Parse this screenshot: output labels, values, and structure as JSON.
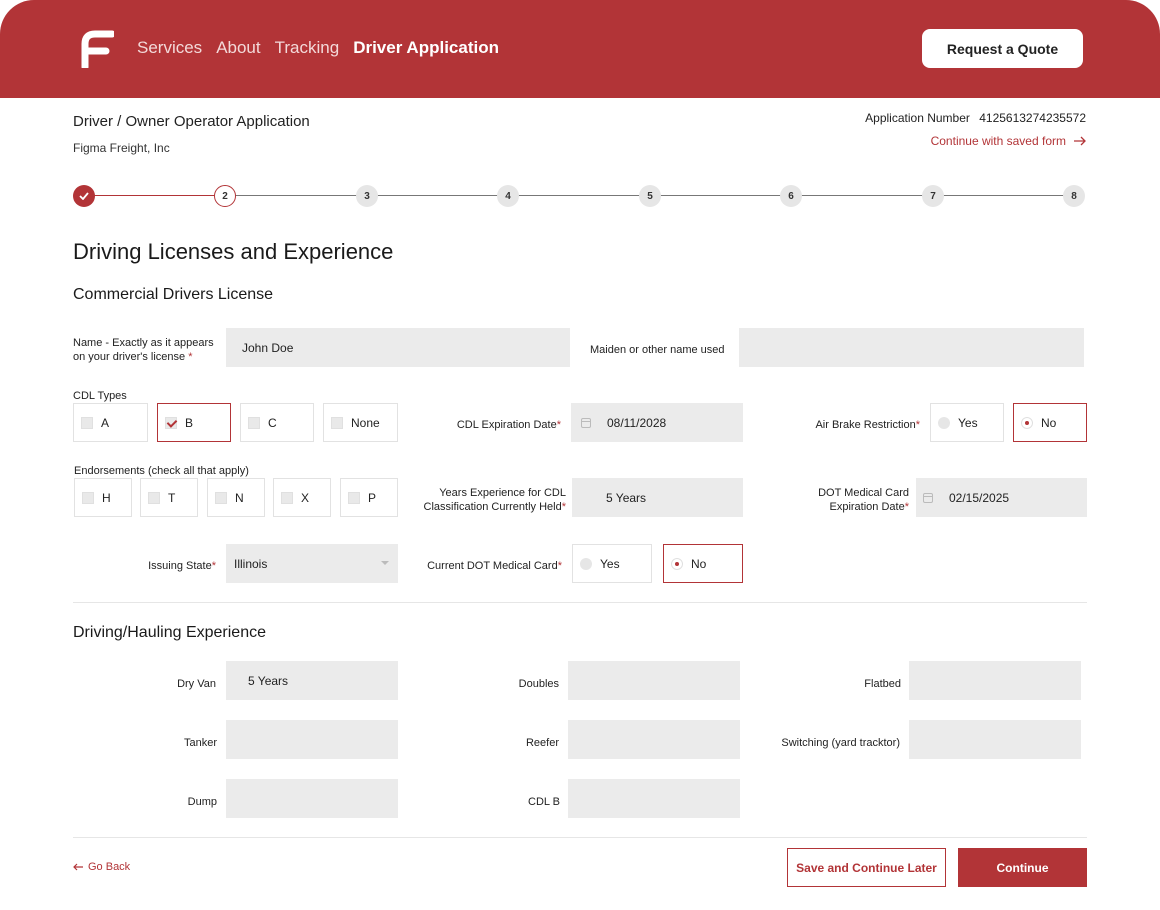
{
  "nav": {
    "items": [
      "Services",
      "About",
      "Tracking",
      "Driver Application"
    ],
    "active_index": 3,
    "quote_button": "Request a Quote"
  },
  "application": {
    "title": "Driver / Owner Operator Application",
    "company": "Figma Freight, Inc",
    "number_label": "Application Number",
    "number": "4125613274235572",
    "saved_link": "Continue with saved form"
  },
  "stepper": {
    "steps": [
      "2",
      "3",
      "4",
      "5",
      "6",
      "7",
      "8"
    ],
    "completed": 1,
    "current": 2,
    "total": 8
  },
  "section": {
    "title": "Driving Licenses and Experience",
    "cdl_heading": "Commercial Drivers License",
    "hauling_heading": "Driving/Hauling Experience"
  },
  "cdl": {
    "name_label_1": "Name - Exactly as it appears",
    "name_label_2": "on your driver's license",
    "name_value": "John Doe",
    "maiden_label": "Maiden or other name used",
    "maiden_value": "",
    "types_label": "CDL Types",
    "types": [
      {
        "label": "A",
        "checked": false
      },
      {
        "label": "B",
        "checked": true
      },
      {
        "label": "C",
        "checked": false
      },
      {
        "label": "None",
        "checked": false
      }
    ],
    "expiration_label": "CDL Expiration Date",
    "expiration_value": "08/11/2028",
    "air_brake_label": "Air Brake Restriction",
    "air_brake_yes": "Yes",
    "air_brake_no": "No",
    "air_brake_selected": "No",
    "endorsements_label": "Endorsements (check all that apply)",
    "endorsements": [
      {
        "label": "H",
        "checked": false
      },
      {
        "label": "T",
        "checked": false
      },
      {
        "label": "N",
        "checked": false
      },
      {
        "label": "X",
        "checked": false
      },
      {
        "label": "P",
        "checked": false
      }
    ],
    "years_label_1": "Years Experience for CDL",
    "years_label_2": "Classification Currently Held",
    "years_value": "5 Years",
    "dot_exp_label_1": "DOT Medical Card",
    "dot_exp_label_2": "Expiration Date",
    "dot_exp_value": "02/15/2025",
    "issuing_state_label": "Issuing State",
    "issuing_state_value": "Illinois",
    "dot_card_label": "Current DOT Medical Card",
    "dot_card_yes": "Yes",
    "dot_card_no": "No",
    "dot_card_selected": "No"
  },
  "hauling": {
    "dry_van_label": "Dry Van",
    "dry_van_value": "5 Years",
    "doubles_label": "Doubles",
    "doubles_value": "",
    "flatbed_label": "Flatbed",
    "flatbed_value": "",
    "tanker_label": "Tanker",
    "tanker_value": "",
    "reefer_label": "Reefer",
    "reefer_value": "",
    "switching_label": "Switching (yard tracktor)",
    "switching_value": "",
    "dump_label": "Dump",
    "dump_value": "",
    "cdlb_label": "CDL B",
    "cdlb_value": ""
  },
  "footer": {
    "go_back": "Go Back",
    "save_later": "Save and Continue Later",
    "continue": "Continue"
  },
  "colors": {
    "brand": "#b23437",
    "field_bg": "#ebebeb"
  },
  "required_mark": "*"
}
